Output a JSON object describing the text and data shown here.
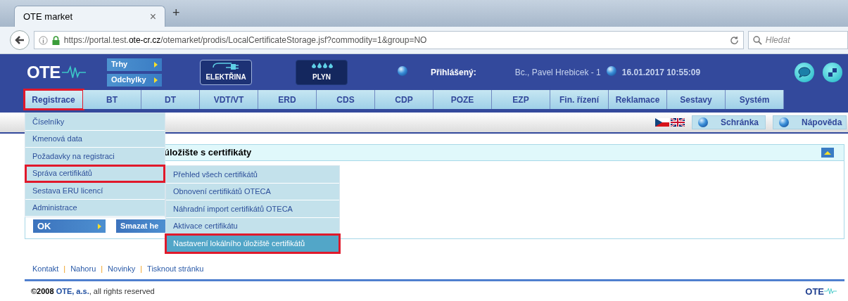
{
  "browser": {
    "tab_title": "OTE market",
    "tab_close": "×",
    "new_tab": "+",
    "url": "https://portal.test.**ote-cr.cz**/otemarket/prodis/LocalCertificateStorage.jsf?commodity=1&group=NO",
    "search_placeholder": "Hledat"
  },
  "header": {
    "logo": "OTE",
    "side_buttons": [
      "Trhy",
      "Odchylky"
    ],
    "commodities": [
      {
        "label": "ELEKTŘINA",
        "kind": "electricity",
        "selected": true
      },
      {
        "label": "PLYN",
        "kind": "gas",
        "selected": false
      }
    ],
    "login_label": "Přihlášený:",
    "user": "Bc., Pavel Hrebicek - 1",
    "datetime": "16.01.2017 10:55:09"
  },
  "nav": [
    {
      "label": "Registrace",
      "selected": true,
      "marked": true
    },
    {
      "label": "BT",
      "selected": false,
      "marked": false
    },
    {
      "label": "DT",
      "selected": false,
      "marked": false
    },
    {
      "label": "VDT/VT",
      "selected": false,
      "marked": false
    },
    {
      "label": "ERD",
      "selected": false,
      "marked": false
    },
    {
      "label": "CDS",
      "selected": false,
      "marked": false
    },
    {
      "label": "CDP",
      "selected": false,
      "marked": false
    },
    {
      "label": "POZE",
      "selected": false,
      "marked": false
    },
    {
      "label": "EZP",
      "selected": false,
      "marked": false
    },
    {
      "label": "Fin. řízení",
      "selected": false,
      "marked": false
    },
    {
      "label": "Reklamace",
      "selected": false,
      "marked": false
    },
    {
      "label": "Sestavy",
      "selected": false,
      "marked": false
    },
    {
      "label": "Systém",
      "selected": false,
      "marked": false
    }
  ],
  "toolbar": {
    "buttons": [
      "Schránka",
      "Nápověda"
    ]
  },
  "panel": {
    "title": "úložište s certifikáty",
    "buttons": [
      "OK",
      "Smazat he"
    ]
  },
  "menu": [
    {
      "label": "Číselníky",
      "marked": false
    },
    {
      "label": "Kmenová data",
      "marked": false
    },
    {
      "label": "Požadavky na registraci",
      "marked": false
    },
    {
      "label": "Správa certifikátů",
      "marked": true
    },
    {
      "label": "Sestava ERU licencí",
      "marked": false
    },
    {
      "label": "Administrace",
      "marked": false
    }
  ],
  "submenu": [
    {
      "label": "Přehled všech certifikátů",
      "selected": false,
      "marked": false
    },
    {
      "label": "Obnovení certifikátů OTECA",
      "selected": false,
      "marked": false
    },
    {
      "label": "Náhradní import certifikátů OTECA",
      "selected": false,
      "marked": false
    },
    {
      "label": "Aktivace certifikátu",
      "selected": false,
      "marked": false
    },
    {
      "label": "Nastavení lokálního úložiště certifikátů",
      "selected": true,
      "marked": true
    }
  ],
  "footer": {
    "links": [
      "Kontakt",
      "Nahoru",
      "Novinky",
      "Tisknout stránku"
    ],
    "separator": "|",
    "copyright": "**©2008** *OTE, a.s.*, all rights reserved",
    "logo": "OTE"
  }
}
